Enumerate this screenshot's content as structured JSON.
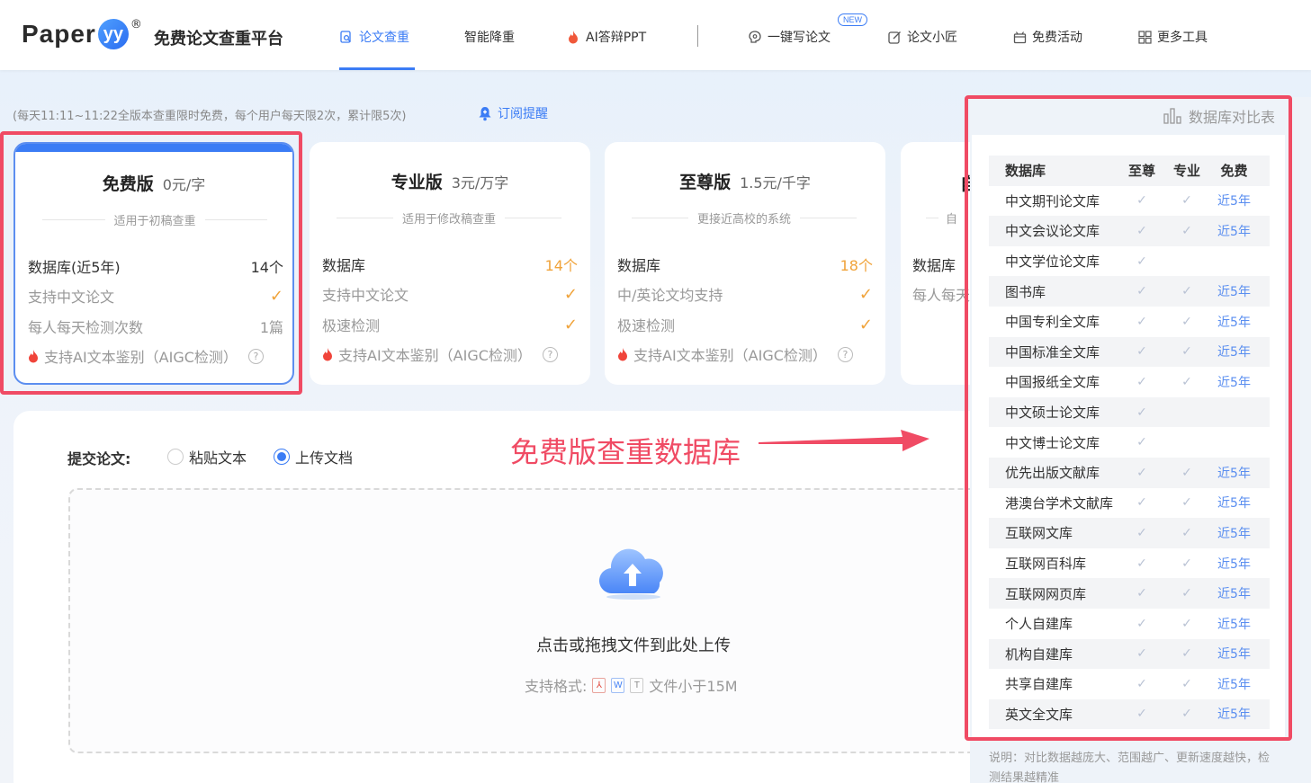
{
  "brand": {
    "logo_text": "Paper",
    "logo_badge": "yy",
    "logo_reg": "®",
    "site_name": "免费论文查重平台"
  },
  "nav": {
    "items": [
      {
        "label": "论文查重",
        "icon": "search-doc-icon",
        "active": true
      },
      {
        "label": "智能降重",
        "icon": ""
      },
      {
        "label": "AI答辩PPT",
        "icon": "fire-icon"
      },
      {
        "label": "一键写论文",
        "icon": "brain-icon",
        "tag": "NEW"
      },
      {
        "label": "论文小匠",
        "icon": "edit-icon"
      },
      {
        "label": "免费活动",
        "icon": "gift-icon"
      },
      {
        "label": "更多工具",
        "icon": "grid-icon"
      }
    ]
  },
  "notice": {
    "text": "(每天11:11~11:22全版本查重限时免费，每个用户每天限2次，累计限5次)",
    "subscribe": "订阅提醒"
  },
  "plans": [
    {
      "name": "免费版",
      "price": "0元/字",
      "subtitle": "适用于初稿查重",
      "rows": [
        {
          "k": "数据库(近5年)",
          "v": "14个"
        },
        {
          "k": "支持中文论文",
          "v": "✓"
        },
        {
          "k": "每人每天检测次数",
          "v": "1篇"
        }
      ],
      "aigc": "支持AI文本鉴别（AIGC检测）"
    },
    {
      "name": "专业版",
      "price": "3元/万字",
      "subtitle": "适用于修改稿查重",
      "rows": [
        {
          "k": "数据库",
          "v": "14个"
        },
        {
          "k": "支持中文论文",
          "v": "✓"
        },
        {
          "k": "极速检测",
          "v": "✓"
        }
      ],
      "aigc": "支持AI文本鉴别（AIGC检测）"
    },
    {
      "name": "至尊版",
      "price": "1.5元/千字",
      "subtitle": "更接近高校的系统",
      "rows": [
        {
          "k": "数据库",
          "v": "18个"
        },
        {
          "k": "中/英论文均支持",
          "v": "✓"
        },
        {
          "k": "极速检测",
          "v": "✓"
        }
      ],
      "aigc": "支持AI文本鉴别（AIGC检测）"
    },
    {
      "name": "自",
      "price": "",
      "subtitle": "自",
      "rows": [
        {
          "k": "数据库",
          "v": ""
        },
        {
          "k": "每人每天",
          "v": ""
        }
      ],
      "aigc": ""
    }
  ],
  "upload": {
    "submit_label": "提交论文:",
    "option_paste": "粘贴文本",
    "option_upload": "上传文档",
    "drop_text": "点击或拖拽文件到此处上传",
    "formats_label": "支持格式:",
    "size_limit": "文件小于15M"
  },
  "annotation": {
    "text": "免费版查重数据库"
  },
  "db_compare": {
    "title": "数据库对比表",
    "columns": [
      "数据库",
      "至尊",
      "专业",
      "免费"
    ],
    "rows": [
      {
        "name": "中文期刊论文库",
        "zhizun": "✓",
        "zhuanye": "✓",
        "free": "近5年"
      },
      {
        "name": "中文会议论文库",
        "zhizun": "✓",
        "zhuanye": "✓",
        "free": "近5年"
      },
      {
        "name": "中文学位论文库",
        "zhizun": "✓",
        "zhuanye": "",
        "free": ""
      },
      {
        "name": "图书库",
        "zhizun": "✓",
        "zhuanye": "✓",
        "free": "近5年"
      },
      {
        "name": "中国专利全文库",
        "zhizun": "✓",
        "zhuanye": "✓",
        "free": "近5年"
      },
      {
        "name": "中国标准全文库",
        "zhizun": "✓",
        "zhuanye": "✓",
        "free": "近5年"
      },
      {
        "name": "中国报纸全文库",
        "zhizun": "✓",
        "zhuanye": "✓",
        "free": "近5年"
      },
      {
        "name": "中文硕士论文库",
        "zhizun": "✓",
        "zhuanye": "",
        "free": ""
      },
      {
        "name": "中文博士论文库",
        "zhizun": "✓",
        "zhuanye": "",
        "free": ""
      },
      {
        "name": "优先出版文献库",
        "zhizun": "✓",
        "zhuanye": "✓",
        "free": "近5年"
      },
      {
        "name": "港澳台学术文献库",
        "zhizun": "✓",
        "zhuanye": "✓",
        "free": "近5年"
      },
      {
        "name": "互联网文库",
        "zhizun": "✓",
        "zhuanye": "✓",
        "free": "近5年"
      },
      {
        "name": "互联网百科库",
        "zhizun": "✓",
        "zhuanye": "✓",
        "free": "近5年"
      },
      {
        "name": "互联网网页库",
        "zhizun": "✓",
        "zhuanye": "✓",
        "free": "近5年"
      },
      {
        "name": "个人自建库",
        "zhizun": "✓",
        "zhuanye": "✓",
        "free": "近5年"
      },
      {
        "name": "机构自建库",
        "zhizun": "✓",
        "zhuanye": "✓",
        "free": "近5年"
      },
      {
        "name": "共享自建库",
        "zhizun": "✓",
        "zhuanye": "✓",
        "free": "近5年"
      },
      {
        "name": "英文全文库",
        "zhizun": "✓",
        "zhuanye": "✓",
        "free": "近5年"
      }
    ],
    "note": "说明：对比数据越庞大、范围越广、更新速度越快，检测结果越精准"
  },
  "colors": {
    "accent": "#3b7cf5",
    "highlight_red": "#f04b64",
    "orange": "#f0a33a"
  }
}
